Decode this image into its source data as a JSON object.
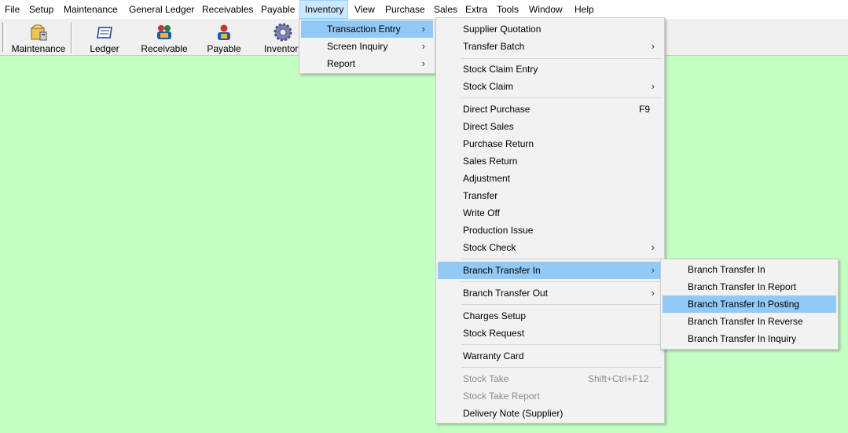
{
  "menubar": {
    "items": [
      "File",
      "Setup",
      "Maintenance",
      "General Ledger",
      "Receivables",
      "Payable",
      "Inventory",
      "View",
      "Purchase",
      "Sales",
      "Extra",
      "Tools",
      "Window",
      "Help"
    ]
  },
  "toolbar": {
    "buttons": [
      "Maintenance",
      "Ledger",
      "Receivable",
      "Payable",
      "Inventory"
    ]
  },
  "inventory_menu": {
    "items": [
      "Transaction Entry",
      "Screen Inquiry",
      "Report"
    ]
  },
  "transaction_menu": {
    "supplier_quotation": "Supplier Quotation",
    "transfer_batch": "Transfer Batch",
    "stock_claim_entry": "Stock Claim Entry",
    "stock_claim": "Stock Claim",
    "direct_purchase": "Direct Purchase",
    "direct_purchase_shortcut": "F9",
    "direct_sales": "Direct Sales",
    "purchase_return": "Purchase Return",
    "sales_return": "Sales Return",
    "adjustment": "Adjustment",
    "transfer": "Transfer",
    "write_off": "Write Off",
    "production_issue": "Production Issue",
    "stock_check": "Stock Check",
    "branch_transfer_in": "Branch Transfer In",
    "branch_transfer_out": "Branch Transfer Out",
    "charges_setup": "Charges Setup",
    "stock_request": "Stock Request",
    "warranty_card": "Warranty Card",
    "stock_take": "Stock Take",
    "stock_take_shortcut": "Shift+Ctrl+F12",
    "stock_take_report": "Stock Take Report",
    "delivery_note": "Delivery Note (Supplier)"
  },
  "branch_menu": {
    "items": [
      "Branch Transfer In",
      "Branch Transfer In Report",
      "Branch Transfer In Posting",
      "Branch Transfer In Reverse",
      "Branch Transfer In Inquiry"
    ]
  },
  "colors": {
    "background": "#c4ffc4",
    "highlight": "#91c9f7",
    "menubar_active": "#cce8ff"
  }
}
